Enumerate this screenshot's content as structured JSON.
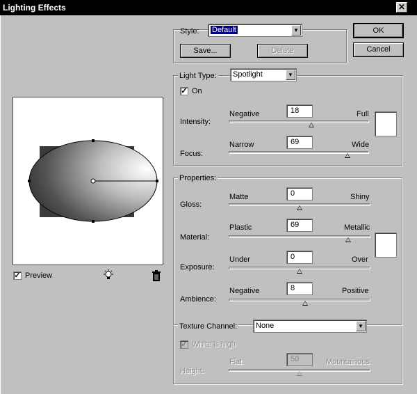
{
  "window": {
    "title": "Lighting Effects",
    "close_glyph": "✕"
  },
  "buttons": {
    "ok": "OK",
    "cancel": "Cancel",
    "save": "Save...",
    "delete": "Delete"
  },
  "style": {
    "label": "Style:",
    "value": "Default"
  },
  "light_type": {
    "legend": "Light Type:",
    "value": "Spotlight",
    "on_label": "On",
    "on_checked": true,
    "intensity": {
      "label": "Intensity:",
      "min_label": "Negative",
      "max_label": "Full",
      "value": "18",
      "level": 0.59
    },
    "focus": {
      "label": "Focus:",
      "min_label": "Narrow",
      "max_label": "Wide",
      "value": "69",
      "level": 0.845
    },
    "color": "#ffffff"
  },
  "properties": {
    "legend": "Properties:",
    "gloss": {
      "label": "Gloss:",
      "min_label": "Matte",
      "max_label": "Shiny",
      "value": "0",
      "level": 0.5
    },
    "material": {
      "label": "Material:",
      "min_label": "Plastic",
      "max_label": "Metallic",
      "value": "69",
      "level": 0.845
    },
    "exposure": {
      "label": "Exposure:",
      "min_label": "Under",
      "max_label": "Over",
      "value": "0",
      "level": 0.5
    },
    "ambience": {
      "label": "Ambience:",
      "min_label": "Negative",
      "max_label": "Positive",
      "value": "8",
      "level": 0.54
    },
    "color": "#ffffff"
  },
  "texture": {
    "legend": "Texture Channel:",
    "value": "None",
    "white_is_high_label": "White is high",
    "white_is_high_checked": true,
    "height": {
      "label": "Height:",
      "min_label": "Flat",
      "max_label": "Mountainous",
      "value": "50",
      "level": 0.5
    }
  },
  "preview": {
    "checkbox_label": "Preview",
    "checked": true,
    "icons": [
      "light-bulb-icon",
      "trash-icon"
    ]
  },
  "colors": {
    "dialog_bg": "#c0c0c0",
    "title_bg": "#000000",
    "select_highlight": "#000080"
  }
}
